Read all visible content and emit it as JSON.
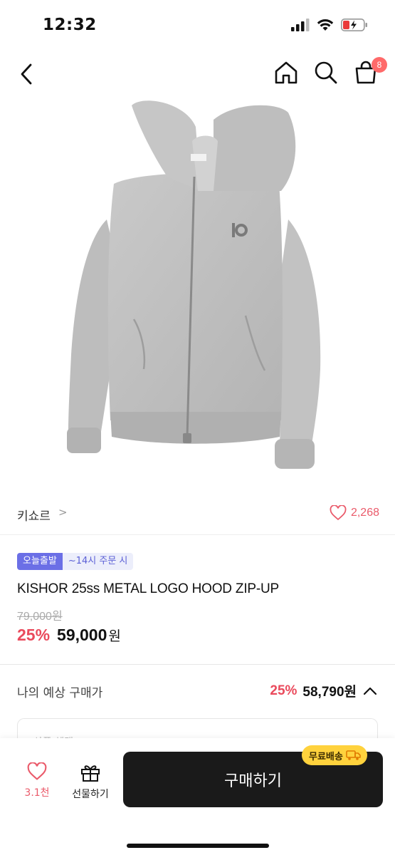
{
  "status_bar": {
    "time": "12:32"
  },
  "nav": {
    "cart_badge": "8"
  },
  "brand": {
    "name": "키쇼르",
    "chevron": ">",
    "like_count": "2,268"
  },
  "tags": {
    "primary": "오늘출발",
    "secondary": "~14시 주문 시"
  },
  "product": {
    "title": "KISHOR 25ss METAL LOGO HOOD ZIP-UP",
    "original_price": "79,000원",
    "discount_rate": "25%",
    "sale_price": "59,000",
    "sale_unit": "원"
  },
  "expected": {
    "label": "나의 예상 구매가",
    "rate": "25%",
    "price": "58,790원"
  },
  "detail_box": {
    "label": "상품 혜택"
  },
  "bottom_bar": {
    "like_count": "3.1천",
    "gift_label": "선물하기",
    "buy_label": "구매하기",
    "free_shipping": "무료배송"
  },
  "colors": {
    "accent_red": "#ea4a5c",
    "tag_purple": "#6b6fe6",
    "ship_yellow": "#ffd23d"
  }
}
